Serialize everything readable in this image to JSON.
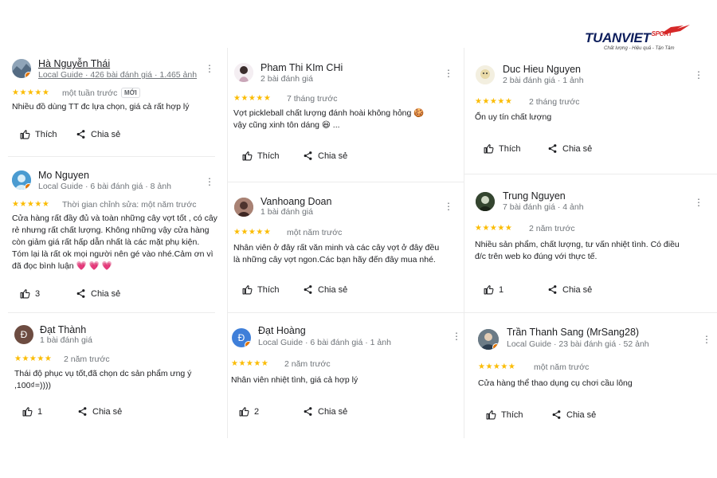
{
  "brand": {
    "name": "TUANVIET",
    "suffix": "SPORT",
    "tagline": "Chất lượng - Hiệu quả - Tận Tâm",
    "colors": {
      "navy": "#0d1e5c",
      "red": "#d62828"
    }
  },
  "ui": {
    "like_label": "Thích",
    "share_label": "Chia sẻ",
    "star_color": "#fbbc04",
    "new_badge": "MỚI"
  },
  "reviews": [
    {
      "name": "Hà Nguyễn Thái",
      "meta": "Local Guide · 426 bài đánh giá · 1.465 ảnh",
      "rating": 5,
      "time": "một tuần trước",
      "review_lines": [
        "Nhiều đồ dùng TT đc lựa chọn, giá cả rất hợp lý"
      ],
      "likes": ""
    },
    {
      "name": "Mo Nguyen",
      "meta": "Local Guide · 6 bài đánh giá · 8 ảnh",
      "rating": 5,
      "time": "Thời gian chỉnh sửa: một năm trước",
      "review_lines": [
        "Cửa hàng rất đầy đủ và toàn những cây vợt tốt , có cây",
        "rẻ nhưng rất chất lượng. Không những vậy cửa hàng",
        "còn giảm giá rất hấp dẫn nhất là các mặt phụ kiện.",
        "Tóm lại là rất ok mọi người nên gé vào nhé.Cảm ơn vì",
        "đã đọc bình luận 💗 💗 💗"
      ],
      "likes": "3"
    },
    {
      "name": "Đạt Thành",
      "meta": "1 bài đánh giá",
      "rating": 5,
      "time": "2 năm trước",
      "review_lines": [
        "Thái độ phục vụ tốt,đã chọn dc sản phẩm ưng ý",
        ",100₫=))))"
      ],
      "likes": "1",
      "avatar_letter": "Đ"
    },
    {
      "name": "Pham Thi KIm CHi",
      "meta": "2 bài đánh giá",
      "rating": 5,
      "time": "7 tháng trước",
      "review_lines": [
        "Vợt pickleball chất lượng đánh hoài không hỏng 🍪",
        "vậy cũng xinh tôn dáng 😆 ..."
      ],
      "likes": ""
    },
    {
      "name": "Vanhoang Doan",
      "meta": "1 bài đánh giá",
      "rating": 5,
      "time": "một năm trước",
      "review_lines": [
        "Nhân viên ở đây rất văn minh và các cây vợt ở đây đều",
        "là những cây vợt ngon.Các bạn hãy đến đây mua nhé."
      ],
      "likes": ""
    },
    {
      "name": "Đạt Hoàng",
      "meta": "Local Guide · 6 bài đánh giá · 1 ảnh",
      "rating": 5,
      "time": "2 năm trước",
      "review_lines": [
        "Nhân viên nhiệt tình, giá cả hợp lý"
      ],
      "likes": "2",
      "avatar_letter": "Đ"
    },
    {
      "name": "Duc Hieu Nguyen",
      "meta": "2 bài đánh giá · 1 ảnh",
      "rating": 5,
      "time": "2 tháng trước",
      "review_lines": [
        "Ổn uy tín chất lượng"
      ],
      "likes": ""
    },
    {
      "name": "Trung Nguyen",
      "meta": "7 bài đánh giá · 4 ảnh",
      "rating": 5,
      "time": "2 năm trước",
      "review_lines": [
        "Nhiều sản phẩm, chất lượng, tư vấn nhiệt tình. Có điều",
        "đ/c trên web ko đúng với thực tế."
      ],
      "likes": "1"
    },
    {
      "name": "Trần Thanh Sang (MrSang28)",
      "meta": "Local Guide · 23 bài đánh giá · 52 ảnh",
      "rating": 5,
      "time": "một năm trước",
      "review_lines": [
        "Cửa hàng thể thao dụng cụ chơi cầu lông"
      ],
      "likes": ""
    }
  ]
}
